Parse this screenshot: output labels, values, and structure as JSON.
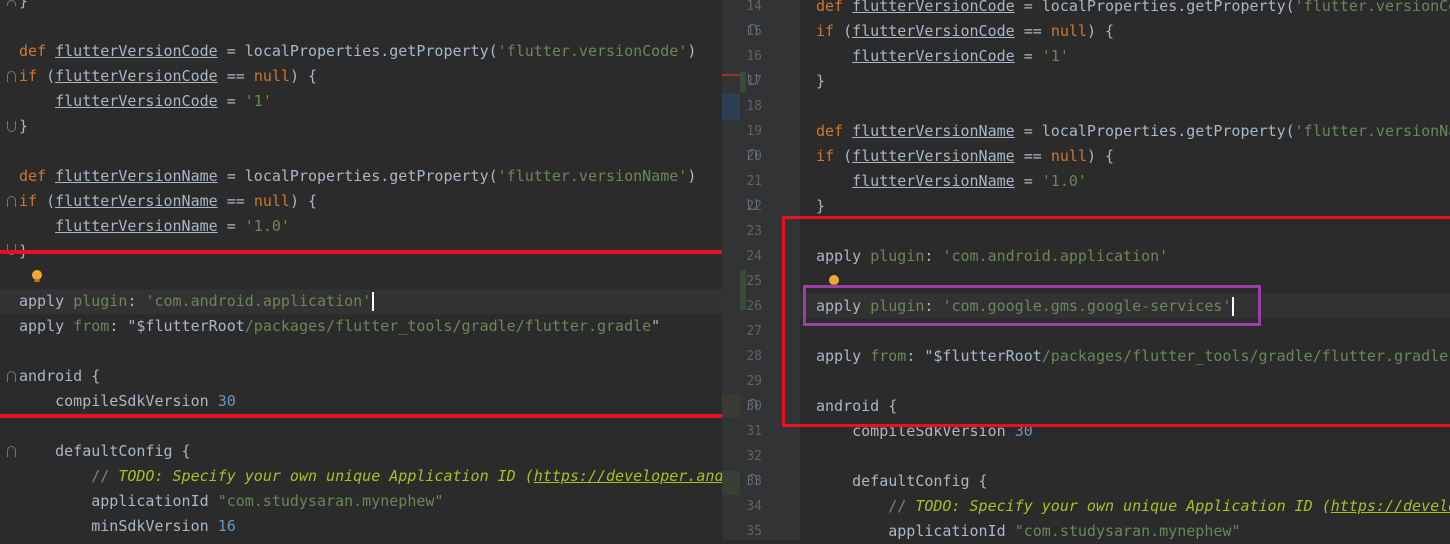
{
  "left": {
    "lines": [
      {
        "segs": [
          {
            "c": "plain",
            "t": "}"
          }
        ]
      },
      {
        "segs": []
      },
      {
        "segs": [
          {
            "c": "kw",
            "t": "def "
          },
          {
            "c": "ul",
            "t": "flutterVersionCode"
          },
          {
            "c": "plain",
            "t": " = localProperties.getProperty("
          },
          {
            "c": "str",
            "t": "'flutter.versionCode'"
          },
          {
            "c": "plain",
            "t": ")"
          }
        ]
      },
      {
        "segs": [
          {
            "c": "kw",
            "t": "if "
          },
          {
            "c": "plain",
            "t": "("
          },
          {
            "c": "ul",
            "t": "flutterVersionCode"
          },
          {
            "c": "plain",
            "t": " == "
          },
          {
            "c": "kw",
            "t": "null"
          },
          {
            "c": "plain",
            "t": ") {"
          }
        ]
      },
      {
        "segs": [
          {
            "c": "plain",
            "t": "    "
          },
          {
            "c": "ul",
            "t": "flutterVersionCode"
          },
          {
            "c": "plain",
            "t": " = "
          },
          {
            "c": "str",
            "t": "'1'"
          }
        ]
      },
      {
        "segs": [
          {
            "c": "plain",
            "t": "}"
          }
        ]
      },
      {
        "segs": []
      },
      {
        "segs": [
          {
            "c": "kw",
            "t": "def "
          },
          {
            "c": "ul",
            "t": "flutterVersionName"
          },
          {
            "c": "plain",
            "t": " = localProperties.getProperty("
          },
          {
            "c": "str",
            "t": "'flutter.versionName'"
          },
          {
            "c": "plain",
            "t": ")"
          }
        ]
      },
      {
        "segs": [
          {
            "c": "kw",
            "t": "if "
          },
          {
            "c": "plain",
            "t": "("
          },
          {
            "c": "ul",
            "t": "flutterVersionName"
          },
          {
            "c": "plain",
            "t": " == "
          },
          {
            "c": "kw",
            "t": "null"
          },
          {
            "c": "plain",
            "t": ") {"
          }
        ]
      },
      {
        "segs": [
          {
            "c": "plain",
            "t": "    "
          },
          {
            "c": "ul",
            "t": "flutterVersionName"
          },
          {
            "c": "plain",
            "t": " = "
          },
          {
            "c": "str",
            "t": "'1.0'"
          }
        ]
      },
      {
        "segs": [
          {
            "c": "plain",
            "t": "}"
          }
        ]
      },
      {
        "segs": []
      },
      {
        "segs": [
          {
            "c": "plain",
            "t": "apply "
          },
          {
            "c": "pl",
            "t": "plugin"
          },
          {
            "c": "plain",
            "t": ": "
          },
          {
            "c": "str",
            "t": "'com.android.application'"
          }
        ],
        "cursor": true
      },
      {
        "segs": [
          {
            "c": "plain",
            "t": "apply "
          },
          {
            "c": "pl",
            "t": "from"
          },
          {
            "c": "plain",
            "t": ": "
          },
          {
            "c": "plain",
            "t": "\"$flutterRoot"
          },
          {
            "c": "str",
            "t": "/packages/flutter_tools/gradle/flutter.gradle"
          },
          {
            "c": "plain",
            "t": "\""
          }
        ]
      },
      {
        "segs": []
      },
      {
        "segs": [
          {
            "c": "plain",
            "t": "android {"
          }
        ]
      },
      {
        "segs": [
          {
            "c": "plain",
            "t": "    compileSdkVersion "
          },
          {
            "c": "num",
            "t": "30"
          }
        ]
      },
      {
        "segs": []
      },
      {
        "segs": [
          {
            "c": "plain",
            "t": "    defaultConfig {"
          }
        ]
      },
      {
        "segs": [
          {
            "c": "plain",
            "t": "        "
          },
          {
            "c": "cmt",
            "t": "// "
          },
          {
            "c": "todo",
            "t": "TODO: Specify your own unique Application ID ("
          },
          {
            "c": "todo-link",
            "t": "https://developer.android.com/studio/build/application-id.html"
          },
          {
            "c": "todo",
            "t": ")."
          }
        ]
      },
      {
        "segs": [
          {
            "c": "plain",
            "t": "        applicationId "
          },
          {
            "c": "str",
            "t": "\"com.studysaran.mynephew\""
          }
        ]
      },
      {
        "segs": [
          {
            "c": "plain",
            "t": "        minSdkVersion "
          },
          {
            "c": "num",
            "t": "16"
          }
        ]
      }
    ]
  },
  "right": {
    "line_numbers": [
      "14",
      "15",
      "16",
      "17",
      "18",
      "19",
      "20",
      "21",
      "22",
      "23",
      "24",
      "25",
      "26",
      "27",
      "28",
      "29",
      "30",
      "31",
      "32",
      "33",
      "34",
      "35"
    ],
    "lines": [
      {
        "segs": [
          {
            "c": "kw",
            "t": "def "
          },
          {
            "c": "ul",
            "t": "flutterVersionCode"
          },
          {
            "c": "plain",
            "t": " = localProperties.getProperty("
          },
          {
            "c": "str",
            "t": "'flutter.versionCode'"
          },
          {
            "c": "plain",
            "t": ")"
          }
        ]
      },
      {
        "segs": [
          {
            "c": "kw",
            "t": "if "
          },
          {
            "c": "plain",
            "t": "("
          },
          {
            "c": "ul",
            "t": "flutterVersionCode"
          },
          {
            "c": "plain",
            "t": " == "
          },
          {
            "c": "kw",
            "t": "null"
          },
          {
            "c": "plain",
            "t": ") {"
          }
        ]
      },
      {
        "segs": [
          {
            "c": "plain",
            "t": "    "
          },
          {
            "c": "ul",
            "t": "flutterVersionCode"
          },
          {
            "c": "plain",
            "t": " = "
          },
          {
            "c": "str",
            "t": "'1'"
          }
        ]
      },
      {
        "segs": [
          {
            "c": "plain",
            "t": "}"
          }
        ]
      },
      {
        "segs": []
      },
      {
        "segs": [
          {
            "c": "kw",
            "t": "def "
          },
          {
            "c": "ul",
            "t": "flutterVersionName"
          },
          {
            "c": "plain",
            "t": " = localProperties.getProperty("
          },
          {
            "c": "str",
            "t": "'flutter.versionName'"
          },
          {
            "c": "plain",
            "t": ")"
          }
        ]
      },
      {
        "segs": [
          {
            "c": "kw",
            "t": "if "
          },
          {
            "c": "plain",
            "t": "("
          },
          {
            "c": "ul",
            "t": "flutterVersionName"
          },
          {
            "c": "plain",
            "t": " == "
          },
          {
            "c": "kw",
            "t": "null"
          },
          {
            "c": "plain",
            "t": ") {"
          }
        ]
      },
      {
        "segs": [
          {
            "c": "plain",
            "t": "    "
          },
          {
            "c": "ul",
            "t": "flutterVersionName"
          },
          {
            "c": "plain",
            "t": " = "
          },
          {
            "c": "str",
            "t": "'1.0'"
          }
        ]
      },
      {
        "segs": [
          {
            "c": "plain",
            "t": "}"
          }
        ]
      },
      {
        "segs": []
      },
      {
        "segs": [
          {
            "c": "plain",
            "t": "apply "
          },
          {
            "c": "pl",
            "t": "plugin"
          },
          {
            "c": "plain",
            "t": ": "
          },
          {
            "c": "str",
            "t": "'com.android.application'"
          }
        ]
      },
      {
        "segs": []
      },
      {
        "segs": [
          {
            "c": "plain",
            "t": "apply "
          },
          {
            "c": "pl",
            "t": "plugin"
          },
          {
            "c": "plain",
            "t": ": "
          },
          {
            "c": "str",
            "t": "'com.google.gms.google-services'"
          }
        ],
        "cursor": true
      },
      {
        "segs": []
      },
      {
        "segs": [
          {
            "c": "plain",
            "t": "apply "
          },
          {
            "c": "pl",
            "t": "from"
          },
          {
            "c": "plain",
            "t": ": "
          },
          {
            "c": "plain",
            "t": "\"$flutterRoot"
          },
          {
            "c": "str",
            "t": "/packages/flutter_tools/gradle/flutter.gradle"
          },
          {
            "c": "plain",
            "t": "\""
          }
        ]
      },
      {
        "segs": []
      },
      {
        "segs": [
          {
            "c": "plain",
            "t": "android {"
          }
        ]
      },
      {
        "segs": [
          {
            "c": "plain",
            "t": "    compileSdkVersion "
          },
          {
            "c": "num",
            "t": "30"
          }
        ]
      },
      {
        "segs": []
      },
      {
        "segs": [
          {
            "c": "plain",
            "t": "    defaultConfig {"
          }
        ]
      },
      {
        "segs": [
          {
            "c": "plain",
            "t": "        "
          },
          {
            "c": "cmt",
            "t": "// "
          },
          {
            "c": "todo",
            "t": "TODO: Specify your own unique Application ID ("
          },
          {
            "c": "todo-link",
            "t": "https://developer.android.com/studio/build/application-id.html"
          },
          {
            "c": "todo",
            "t": ")."
          }
        ]
      },
      {
        "segs": [
          {
            "c": "plain",
            "t": "        applicationId "
          },
          {
            "c": "str",
            "t": "\"com.studysaran.mynephew\""
          }
        ]
      }
    ]
  },
  "colors": {
    "annotation_red": "#e81123",
    "annotation_purple": "#9b3fa3",
    "background": "#2b2b2b",
    "keyword": "#cc7832",
    "string": "#6a8759",
    "number": "#6897bb"
  },
  "icons": [
    "lightbulb-icon",
    "fold-marker-icon"
  ]
}
